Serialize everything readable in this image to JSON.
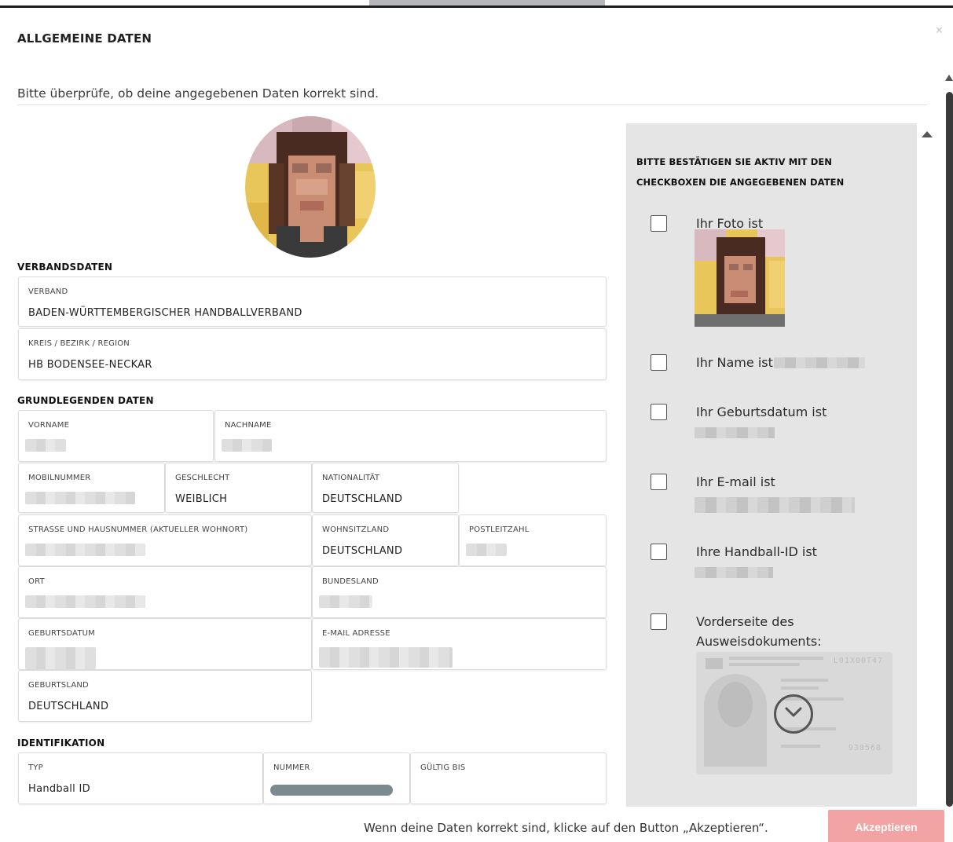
{
  "modal": {
    "title": "ALLGEMEINE DATEN",
    "close_icon": "close-icon",
    "intro": "Bitte überprüfe, ob deine angegebenen Daten korrekt sind."
  },
  "sections": {
    "verband": "VERBANDSDATEN",
    "grund": "GRUNDLEGENDEN DATEN",
    "ident": "IDENTIFIKATION"
  },
  "fields": {
    "verband": {
      "label": "VERBAND",
      "value": "BADEN-WÜRTTEMBERGISCHER HANDBALLVERBAND"
    },
    "kreis": {
      "label": "KREIS / BEZIRK / REGION",
      "value": "HB BODENSEE-NECKAR"
    },
    "vorname": {
      "label": "VORNAME"
    },
    "nachname": {
      "label": "NACHNAME"
    },
    "mobil": {
      "label": "MOBILNUMMER"
    },
    "geschlecht": {
      "label": "GESCHLECHT",
      "value": "WEIBLICH"
    },
    "nationalitaet": {
      "label": "NATIONALITÄT",
      "value": "DEUTSCHLAND"
    },
    "strasse": {
      "label": "STRASSE UND HAUSNUMMER (AKTUELLER WOHNORT)"
    },
    "wohnsitzland": {
      "label": "WOHNSITZLAND",
      "value": "DEUTSCHLAND"
    },
    "plz": {
      "label": "POSTLEITZAHL"
    },
    "ort": {
      "label": "ORT"
    },
    "bundesland": {
      "label": "BUNDESLAND"
    },
    "geburtsdatum": {
      "label": "GEBURTSDATUM"
    },
    "email": {
      "label": "E-MAIL ADRESSE"
    },
    "geburtsland": {
      "label": "GEBURTSLAND",
      "value": "DEUTSCHLAND"
    },
    "typ": {
      "label": "TYP",
      "value": "Handball ID"
    },
    "nummer": {
      "label": "NUMMER"
    },
    "gueltig": {
      "label": "GÜLTIG BIS"
    }
  },
  "confirm": {
    "heading": "BITTE BESTÄTIGEN SIE AKTIV MIT DEN CHECKBOXEN DIE ANGEGEBENEN DATEN",
    "items": [
      {
        "label": "Ihr Foto ist"
      },
      {
        "label": "Ihr Name ist"
      },
      {
        "label": "Ihr Geburtsdatum ist"
      },
      {
        "label": "Ihr E-mail ist"
      },
      {
        "label": "Ihre Handball-ID ist"
      },
      {
        "label": "Vorderseite des Ausweisdokuments:"
      }
    ],
    "id_card": {
      "number_top": "L01X00T47",
      "number_bottom": "938568"
    },
    "scroll_down_icon": "chevron-down-circle-icon"
  },
  "footer": {
    "hint": "Wenn deine Daten korrekt sind, klicke auf den Button „Akzeptieren“.",
    "accept_label": "Akzeptieren"
  },
  "colors": {
    "panel_bg": "#e5e5e5",
    "accept_bg": "#f2a3a3",
    "pill": "#7b8a8f"
  }
}
